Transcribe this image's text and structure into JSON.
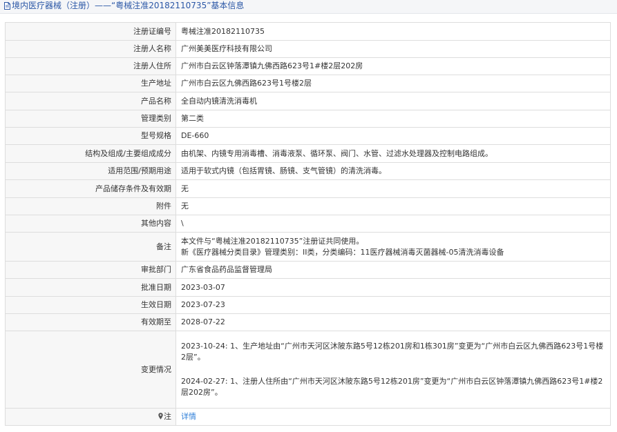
{
  "header": {
    "title": "境内医疗器械（注册）——“粤械注准20182110735”基本信息",
    "icon": "document-icon"
  },
  "rows": [
    {
      "label": "注册证编号",
      "value": "粤械注准20182110735"
    },
    {
      "label": "注册人名称",
      "value": "广州美美医疗科技有限公司"
    },
    {
      "label": "注册人住所",
      "value": "广州市白云区钟落潭镇九佛西路623号1#楼2层202房"
    },
    {
      "label": "生产地址",
      "value": "广州市白云区九佛西路623号1号楼2层"
    },
    {
      "label": "产品名称",
      "value": "全自动内镜清洗消毒机"
    },
    {
      "label": "管理类别",
      "value": "第二类"
    },
    {
      "label": "型号规格",
      "value": "DE-660"
    },
    {
      "label": "结构及组成/主要组成成分",
      "value": "由机架、内镜专用消毒槽、消毒液泵、循环泵、阀门、水管、过滤水处理器及控制电路组成。"
    },
    {
      "label": "适用范围/预期用途",
      "value": "适用于软式内镜（包括胃镜、肠镜、支气管镜）的清洗消毒。"
    },
    {
      "label": "产品储存条件及有效期",
      "value": "无"
    },
    {
      "label": "附件",
      "value": "无"
    },
    {
      "label": "其他内容",
      "value": "\\"
    },
    {
      "label": "备注",
      "lines": [
        "本文件与“粤械注准20182110735”注册证共同使用。",
        "新《医疗器械分类目录》管理类别：II类，分类编码：11医疗器械消毒灭菌器械-05清洗消毒设备"
      ]
    },
    {
      "label": "审批部门",
      "value": "广东省食品药品监督管理局"
    },
    {
      "label": "批准日期",
      "value": "2023-03-07"
    },
    {
      "label": "生效日期",
      "value": "2023-07-23"
    },
    {
      "label": "有效期至",
      "value": "2028-07-22"
    },
    {
      "label": "变更情况",
      "lines": [
        "2023-10-24: 1、生产地址由“广州市天河区沐陂东路5号12栋201房和1栋301房”变更为“广州市白云区九佛西路623号1号楼2层”。",
        "2024-02-27: 1、注册人住所由“广州市天河区沐陂东路5号12栋201房”变更为“广州市白云区钟落潭镇九佛西路623号1#楼2层202房”。"
      ]
    }
  ],
  "note": {
    "label": "注",
    "link_text": "详情",
    "icon": "map-pin-icon"
  },
  "colors": {
    "title": "#2b57a6",
    "link": "#2f7fd8",
    "label_bg": "#f7f7f7",
    "border": "#dddddd"
  }
}
